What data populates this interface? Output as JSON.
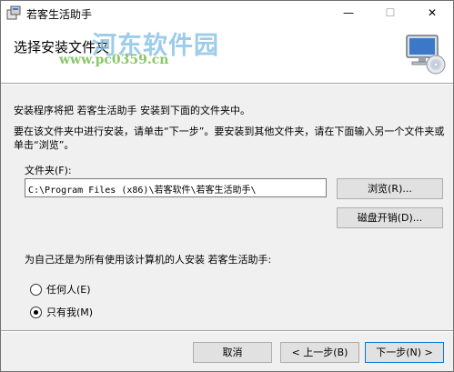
{
  "window": {
    "title": "若客生活助手",
    "controls": {
      "minimize": "—",
      "maximize": "☐",
      "close": "✕"
    }
  },
  "banner": {
    "title": "选择安装文件夹",
    "watermark_logo": "河东软件园",
    "watermark_url": "www.pc0359.cn",
    "icon": "computer-cd-icon"
  },
  "content": {
    "intro": "安装程序将把 若客生活助手 安装到下面的文件夹中。",
    "instruction": "要在该文件夹中进行安装，请单击“下一步”。要安装到其他文件夹，请在下面输入另一个文件夹或单击“浏览”。",
    "folder_label": "文件夹(F):",
    "folder_value": "C:\\Program Files (x86)\\若客软件\\若客生活助手\\",
    "browse_label": "浏览(R)...",
    "disk_cost_label": "磁盘开销(D)...",
    "question": "为自己还是为所有使用该计算机的人安装 若客生活助手:",
    "options": [
      {
        "label": "任何人(E)",
        "checked": false
      },
      {
        "label": "只有我(M)",
        "checked": true
      }
    ]
  },
  "footer": {
    "cancel_label": "取消",
    "prev_label": "< 上一步(B)",
    "next_label": "下一步(N) >"
  }
}
